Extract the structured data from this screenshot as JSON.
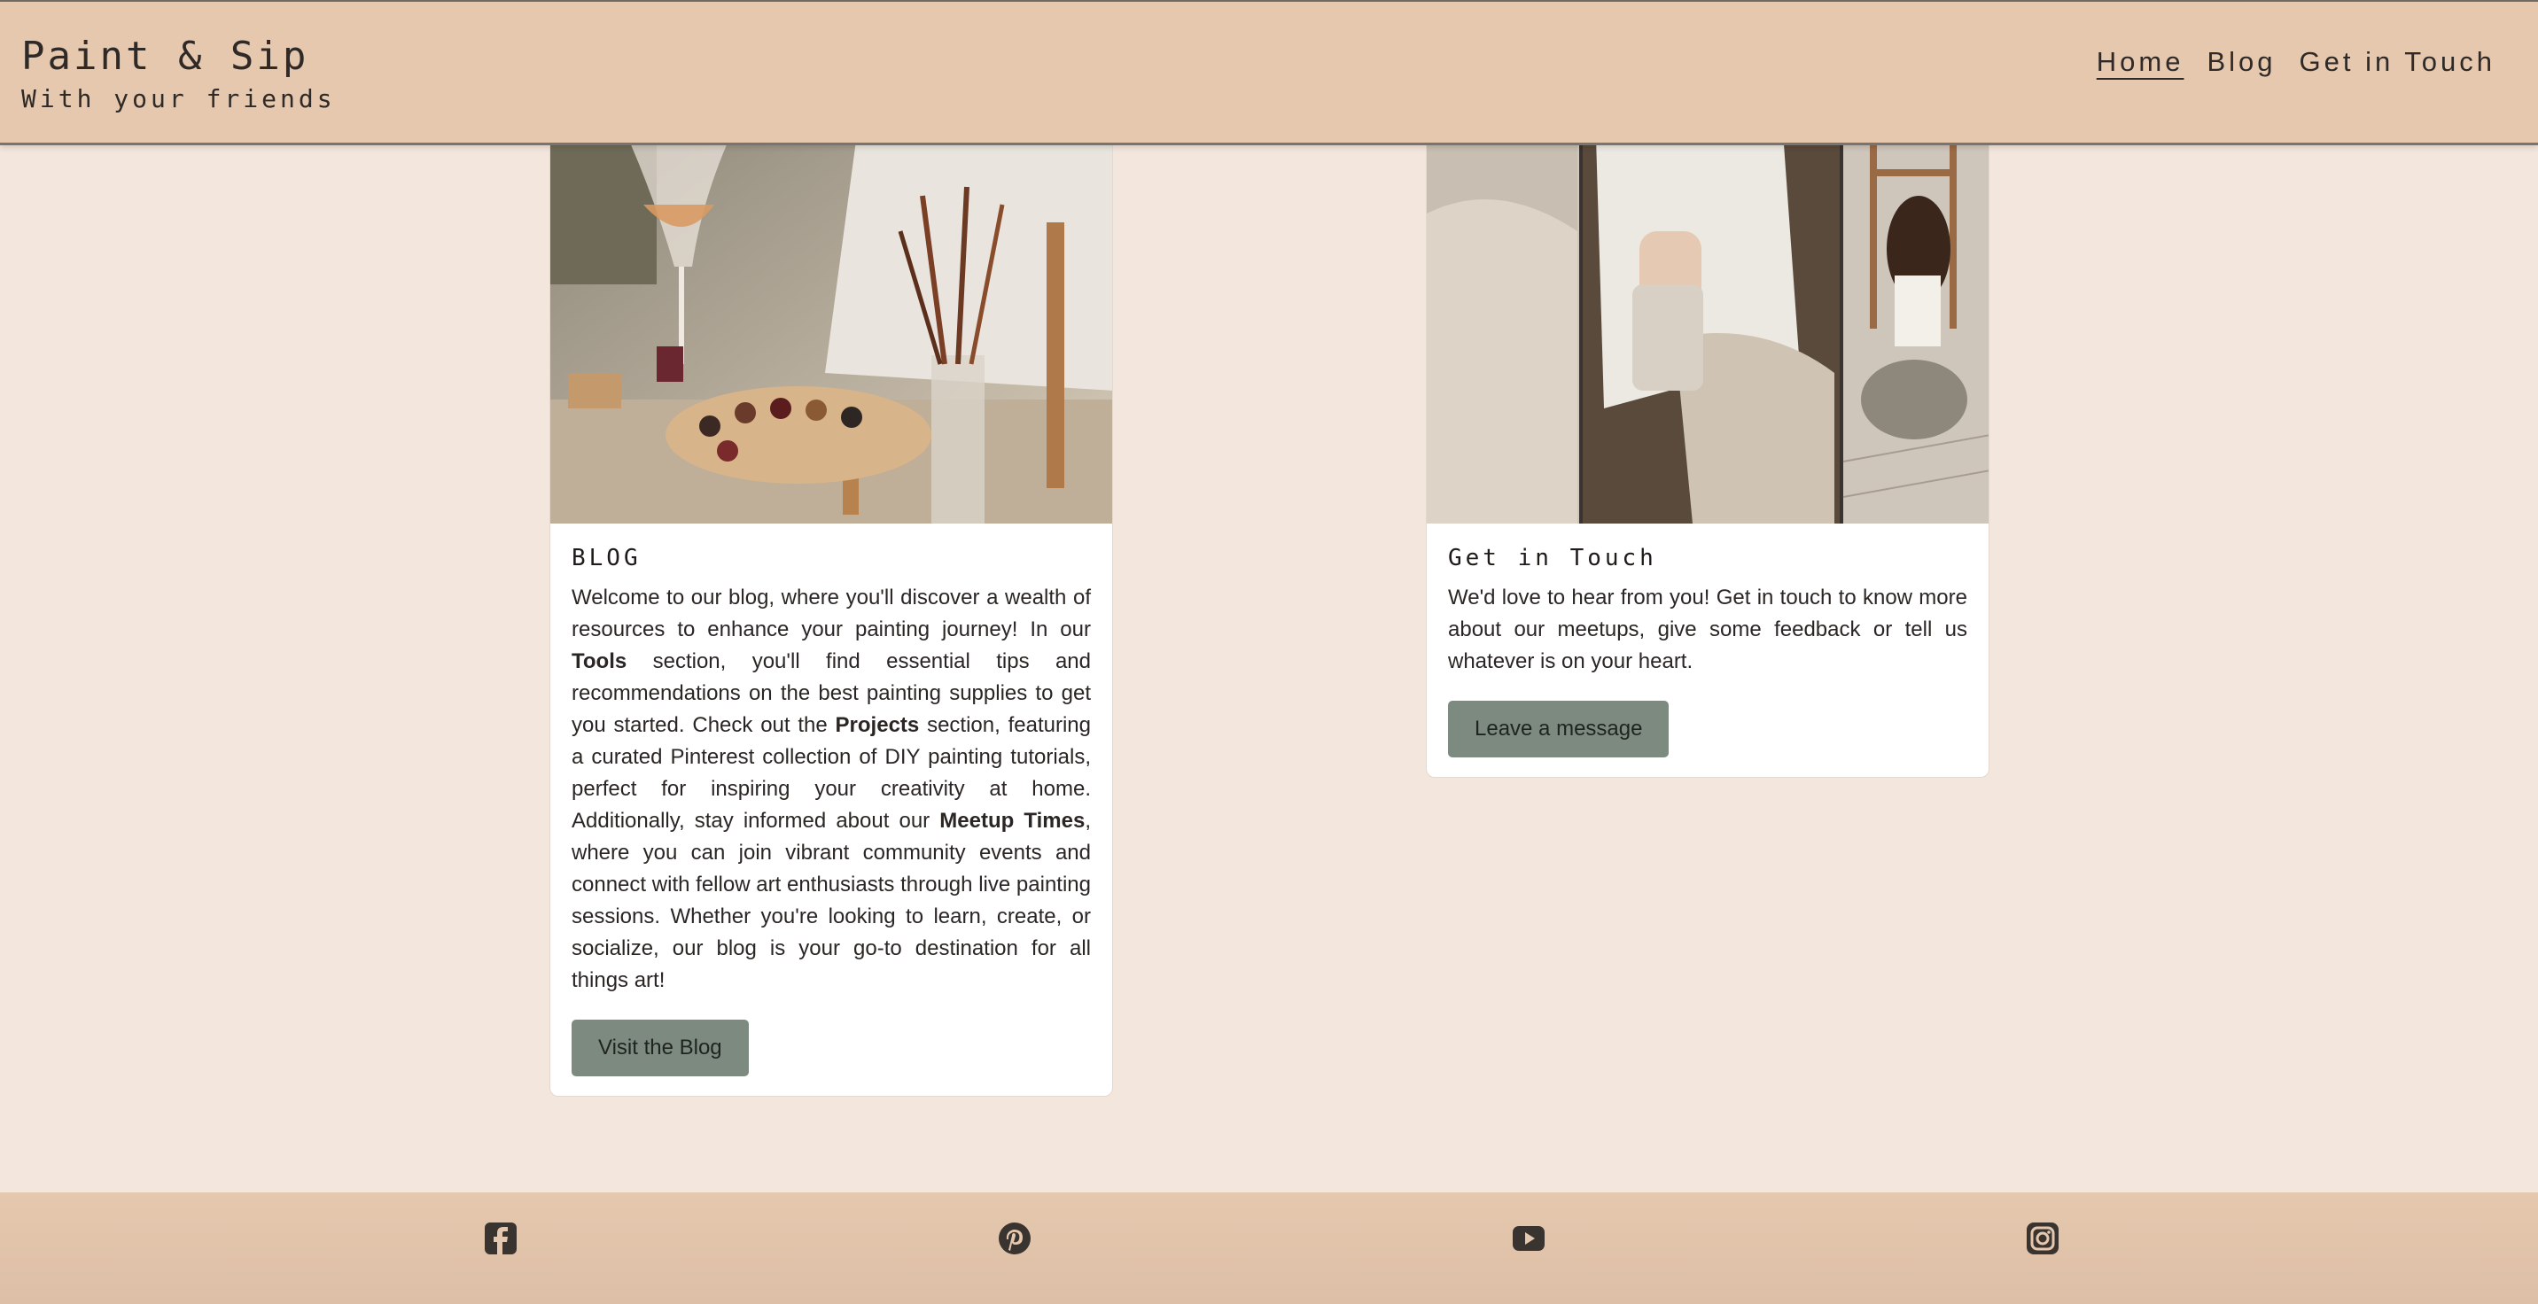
{
  "brand": {
    "title": "Paint & Sip",
    "subtitle": "With your friends"
  },
  "nav": {
    "items": [
      {
        "label": "Home",
        "active": true
      },
      {
        "label": "Blog",
        "active": false
      },
      {
        "label": "Get in Touch",
        "active": false
      }
    ]
  },
  "blog_card": {
    "heading": "BLOG",
    "p1": "Welcome to our blog, where you'll discover a wealth of resources to enhance your painting journey! In our ",
    "tools": "Tools",
    "p2": " section, you'll find essential tips and recommendations on the best painting supplies to get you started. Check out the ",
    "projects": "Projects",
    "p3": " section, featuring a curated Pinterest collection of DIY painting tutorials, perfect for inspiring your creativity at home. Additionally, stay informed about our ",
    "meetup": "Meetup Times",
    "p4": ", where you can join vibrant community events and connect with fellow art enthusiasts through live painting sessions. Whether you're looking to learn, create, or socialize, our blog is your go-to destination for all things art!",
    "button": "Visit the Blog"
  },
  "contact_card": {
    "heading": "Get in Touch",
    "text": "We'd love to hear from you! Get in touch to know more about our meetups, give some feedback or tell us whatever is on your heart.",
    "button": "Leave a message"
  },
  "footer": {
    "icons": [
      "facebook-icon",
      "pinterest-icon",
      "youtube-icon",
      "instagram-icon"
    ]
  },
  "colors": {
    "header_bg": "#e5c8ae",
    "page_bg": "#f3e6dd",
    "button_bg": "#7d8a80"
  }
}
